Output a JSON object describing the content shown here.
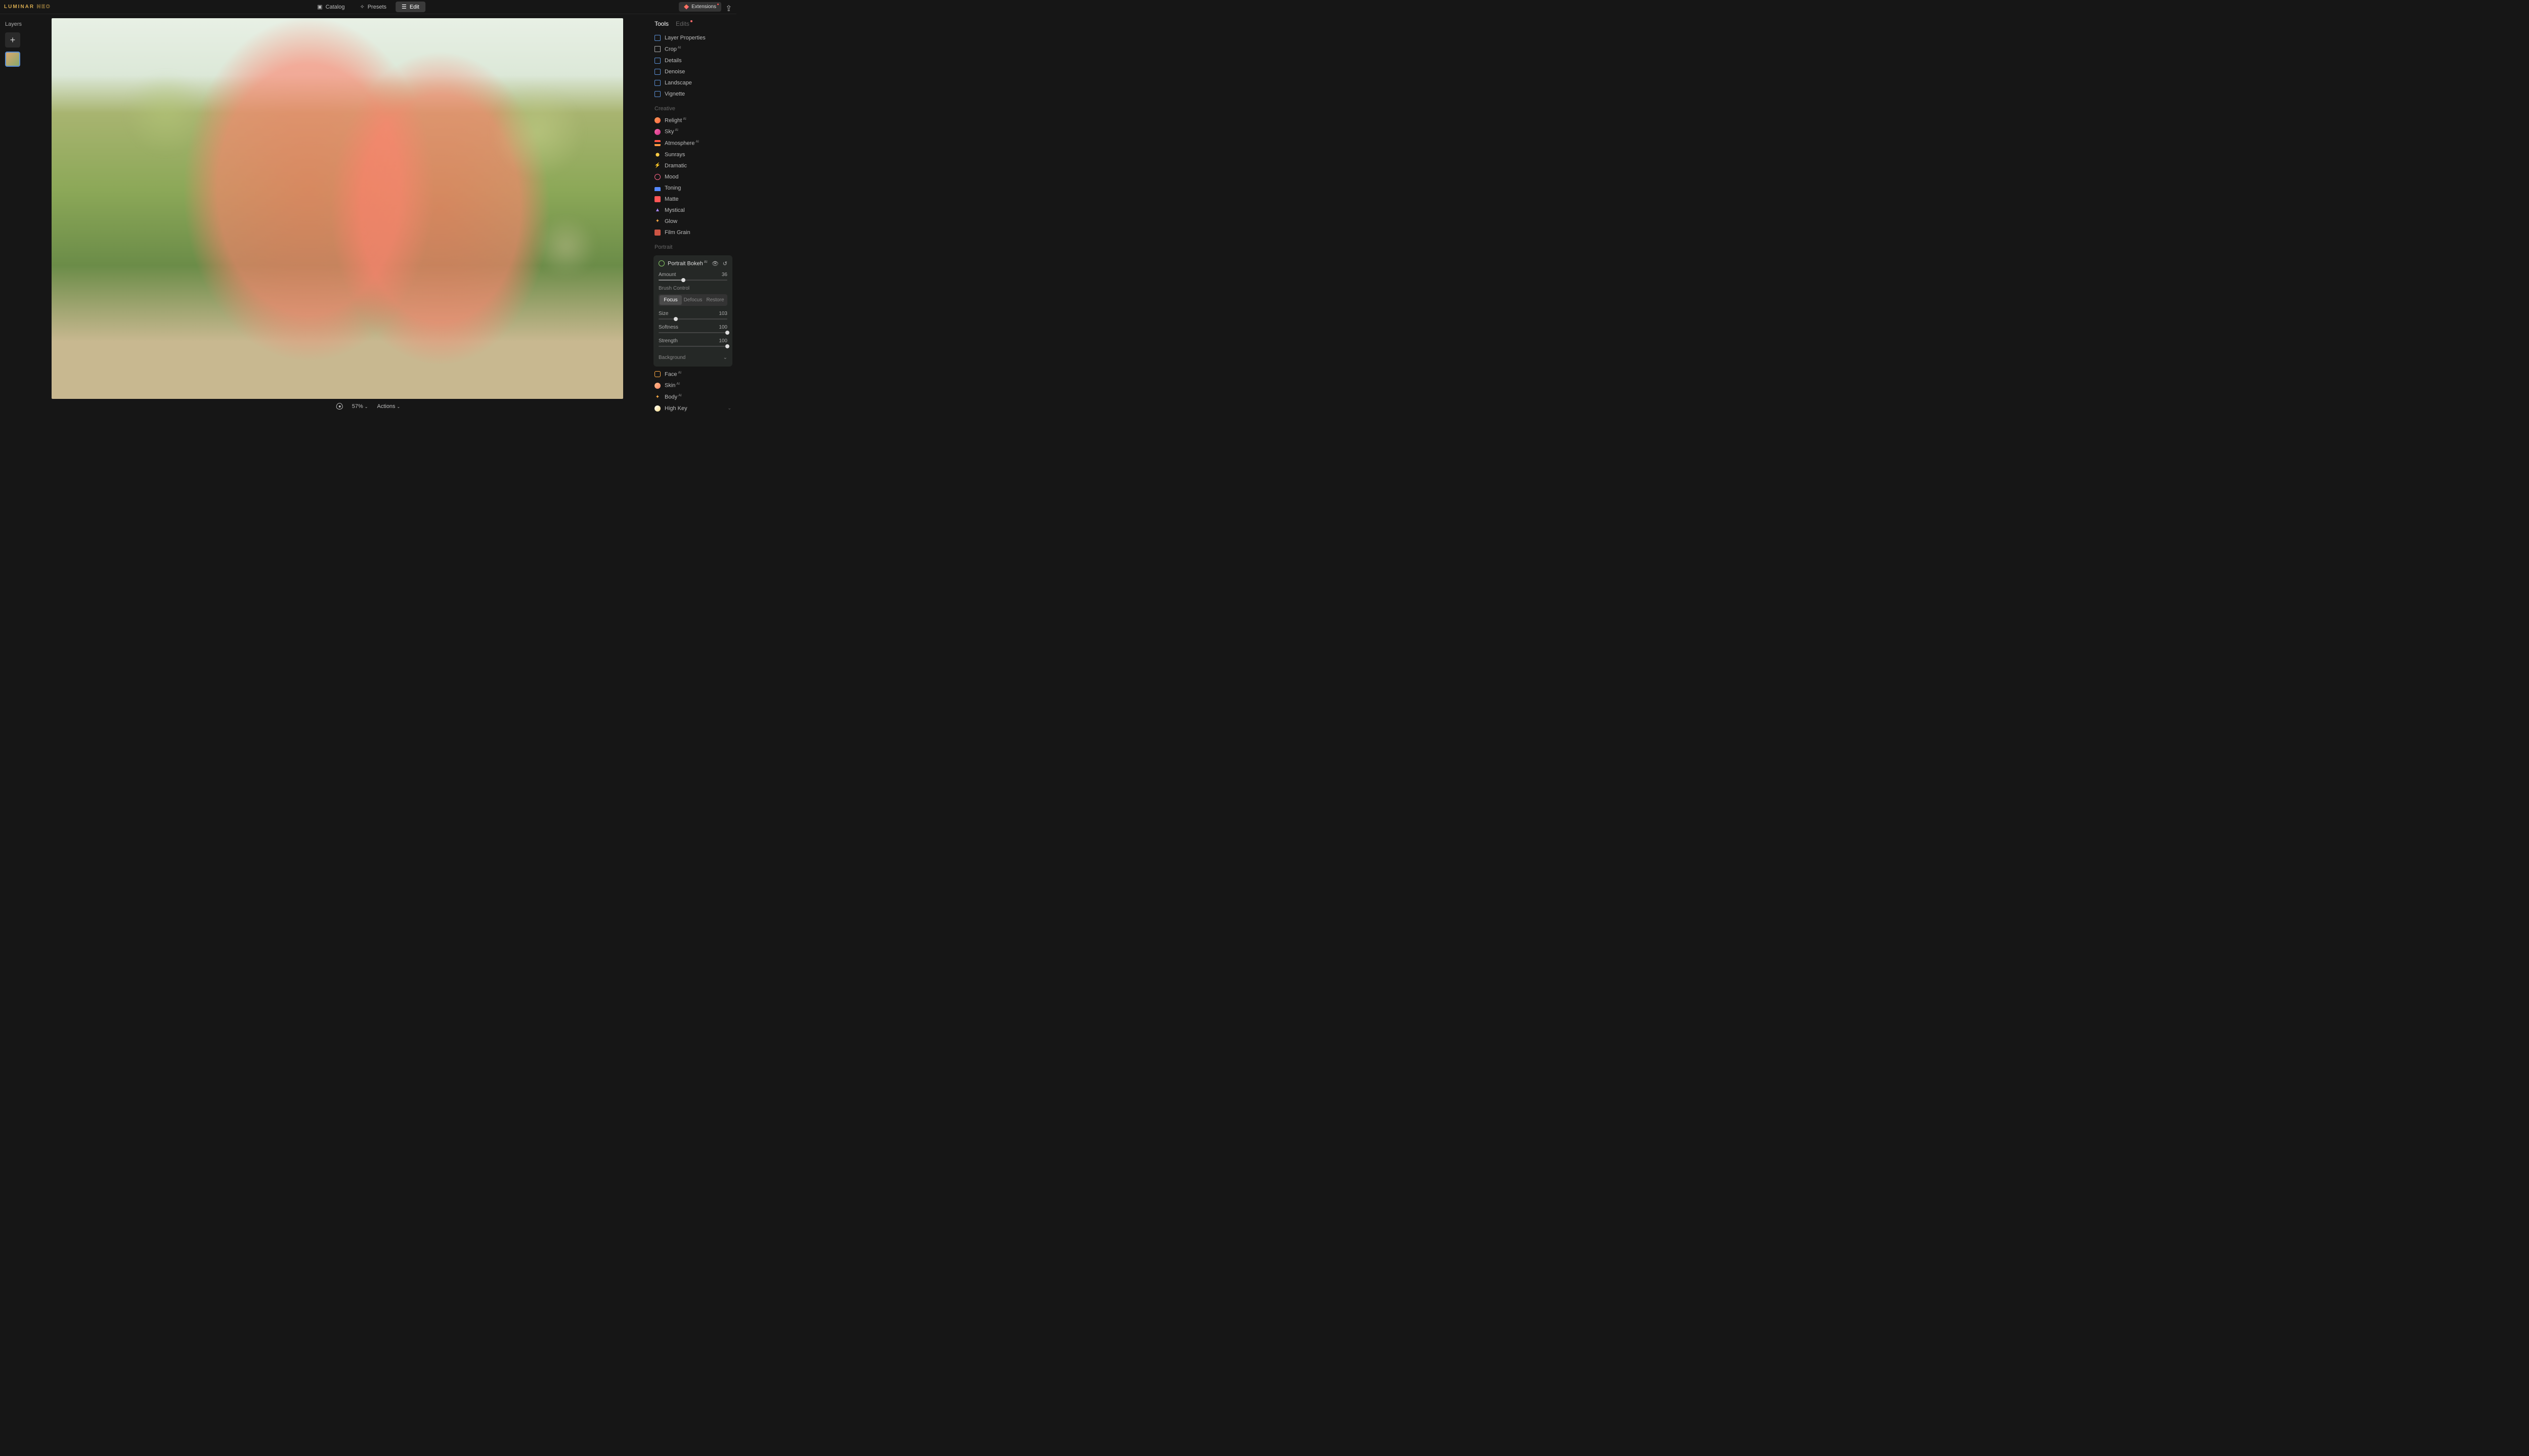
{
  "app": {
    "logo_main": "LUMINAR",
    "logo_sub": "NEO"
  },
  "top": {
    "catalog": "Catalog",
    "presets": "Presets",
    "edit": "Edit",
    "extensions": "Extensions"
  },
  "left": {
    "title": "Layers"
  },
  "bottom": {
    "zoom": "57%",
    "actions": "Actions"
  },
  "tabs": {
    "tools": "Tools",
    "edits": "Edits"
  },
  "essentials": {
    "layer_properties": "Layer Properties",
    "crop": "Crop",
    "details": "Details",
    "denoise": "Denoise",
    "landscape": "Landscape",
    "vignette": "Vignette"
  },
  "creative": {
    "title": "Creative",
    "relight": "Relight",
    "sky": "Sky",
    "atmosphere": "Atmosphere",
    "sunrays": "Sunrays",
    "dramatic": "Dramatic",
    "mood": "Mood",
    "toning": "Toning",
    "matte": "Matte",
    "mystical": "Mystical",
    "glow": "Glow",
    "film_grain": "Film Grain"
  },
  "portrait": {
    "title": "Portrait",
    "bokeh": {
      "title": "Portrait Bokeh",
      "amount_label": "Amount",
      "amount_value": "36",
      "amount_pct": 36,
      "brush_title": "Brush Control",
      "seg": {
        "focus": "Focus",
        "defocus": "Defocus",
        "restore": "Restore"
      },
      "size_label": "Size",
      "size_value": "103",
      "size_pct": 25,
      "softness_label": "Softness",
      "softness_value": "100",
      "softness_pct": 100,
      "strength_label": "Strength",
      "strength_value": "100",
      "strength_pct": 100,
      "background": "Background"
    },
    "face": "Face",
    "skin": "Skin",
    "body": "Body",
    "high_key": "High Key"
  },
  "ai": "AI"
}
